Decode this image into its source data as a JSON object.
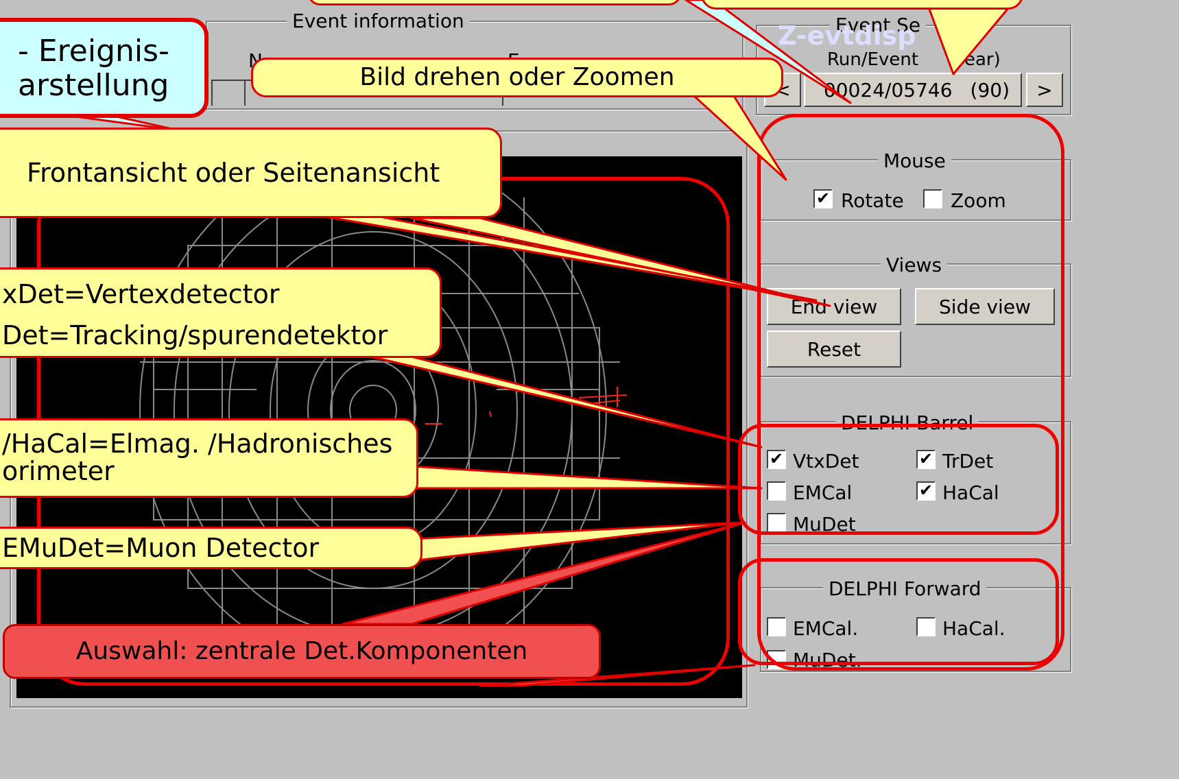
{
  "event_info": {
    "legend": "Event information",
    "col1": "N",
    "col2": "E"
  },
  "event_select": {
    "legend": "Event Se",
    "run_event_label": "Run/Event",
    "year_label": "ear)",
    "run_event_value": "00024/05746",
    "year_value": "(90)",
    "prev_label": "<",
    "next_label": ">",
    "watermark": "Z-evtdisp"
  },
  "mouse": {
    "legend": "Mouse",
    "rotate_label": "Rotate",
    "rotate_checked": true,
    "zoom_label": "Zoom",
    "zoom_checked": false
  },
  "views": {
    "legend": "Views",
    "end_view": "End view",
    "side_view": "Side view",
    "reset": "Reset"
  },
  "barrel": {
    "legend": "DELPHI Barrel",
    "items": [
      {
        "label": "VtxDet",
        "checked": true
      },
      {
        "label": "TrDet",
        "checked": true
      },
      {
        "label": "EMCal",
        "checked": false
      },
      {
        "label": "HaCal",
        "checked": true
      },
      {
        "label": "MuDet",
        "checked": false
      }
    ]
  },
  "forward": {
    "legend": "DELPHI Forward",
    "items": [
      {
        "label": "EMCal.",
        "checked": false
      },
      {
        "label": "HaCal.",
        "checked": false
      },
      {
        "label": "MuDet.",
        "checked": false
      }
    ]
  },
  "callouts": {
    "display_line1": "- Ereignis-",
    "display_line2": "arstellung",
    "rotate_zoom": "Bild drehen oder Zoomen",
    "front_side": "Frontansicht oder Seitenansicht",
    "vtx_line": "xDet=Vertexdetector",
    "tr_line": "Det=Tracking/spurendetektor",
    "cal_line1": "/HaCal=Elmag. /Hadronisches",
    "cal_line2": "orimeter",
    "mu_line": "EMuDet=Muon Detector",
    "selection": "Auswahl: zentrale Det.Komponenten"
  },
  "colors": {
    "panel": "#c0c0c0",
    "callout_yellow": "#ffff99",
    "callout_cyan": "#ccffff",
    "callout_red": "#f05050",
    "accent_red": "#e00000",
    "display_bg": "#000000"
  }
}
